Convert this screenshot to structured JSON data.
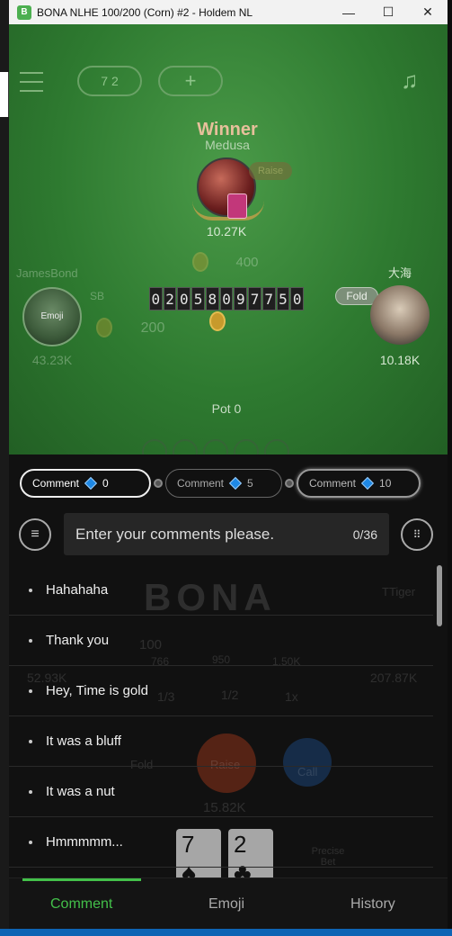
{
  "window": {
    "title": "BONA NLHE 100/200 (Corn) #2 - Holdem NL",
    "app_icon": "B",
    "minimize": "—",
    "maximize": "☐",
    "close": "✕"
  },
  "table": {
    "winner_label": "Winner",
    "winner_name": "Medusa",
    "winner_stack": "10.27K",
    "winner_tag": "Raise",
    "center_bet": "400",
    "counter_digits": [
      "0",
      "2",
      "0",
      "5",
      "8",
      "0",
      "9",
      "7",
      "7",
      "5",
      "0"
    ],
    "left_player_name": "JamesBond",
    "left_player_bet_tag": "SB",
    "left_player_bet": "200",
    "left_player_stack": "43.23K",
    "left_player_action": "Emoji",
    "right_player_name": "大海",
    "right_player_action": "Fold",
    "right_player_stack": "10.18K",
    "pot": "Pot 0",
    "pill_left": "7 2",
    "pill_right": "+"
  },
  "comment_options": [
    {
      "label": "Comment",
      "cost": "0"
    },
    {
      "label": "Comment",
      "cost": "5"
    },
    {
      "label": "Comment",
      "cost": "10"
    }
  ],
  "comment_input": {
    "placeholder": "Enter your comments please.",
    "count": "0/36"
  },
  "quick_comments": [
    "Hahahaha",
    "Thank you",
    "Hey, Time is gold",
    "It was a bluff",
    "It was a nut",
    "Hmmmmm..."
  ],
  "background_ghost": {
    "tiger_name": "TTiger",
    "tiger_stack": "207.87K",
    "left_stack": "52.93K",
    "bet_100": "100",
    "fold": "Fold",
    "raise": "Raise",
    "call": "Call",
    "amount": "15.82K",
    "card1": "7",
    "card2": "2",
    "precise_bet": "Precise Bet",
    "presets": [
      "766",
      "950",
      "1.50K"
    ],
    "fractions": [
      "1/3",
      "1/2",
      "1x"
    ]
  },
  "tabs": [
    "Comment",
    "Emoji",
    "History"
  ],
  "colors": {
    "accent_green": "#43c04a",
    "felt": "#2e7a30",
    "gem_blue": "#1e88e5"
  }
}
